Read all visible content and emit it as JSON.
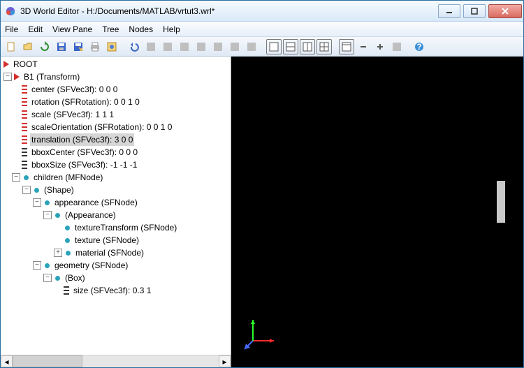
{
  "window": {
    "title": "3D World Editor - H:/Documents/MATLAB/vrtut3.wrl*"
  },
  "menu": {
    "file": "File",
    "edit": "Edit",
    "viewpane": "View Pane",
    "tree": "Tree",
    "nodes": "Nodes",
    "help": "Help"
  },
  "tree": {
    "root": "ROOT",
    "b1": "B1 (Transform)",
    "center": "center (SFVec3f): 0  0  0",
    "rotation": "rotation (SFRotation): 0  0  1  0",
    "scale": "scale (SFVec3f): 1  1  1",
    "scaleOrientation": "scaleOrientation (SFRotation): 0  0  1  0",
    "translation": "translation (SFVec3f): 3  0  0",
    "bboxCenter": "bboxCenter (SFVec3f): 0  0  0",
    "bboxSize": "bboxSize (SFVec3f): -1 -1 -1",
    "children": "children (MFNode)",
    "shape": "(Shape)",
    "appearanceN": "appearance (SFNode)",
    "appearance": "(Appearance)",
    "textureTransform": "textureTransform (SFNode)",
    "texture": "texture (SFNode)",
    "material": "material (SFNode)",
    "geometry": "geometry (SFNode)",
    "box": "(Box)",
    "size": "size (SFVec3f): 0.3         1"
  }
}
